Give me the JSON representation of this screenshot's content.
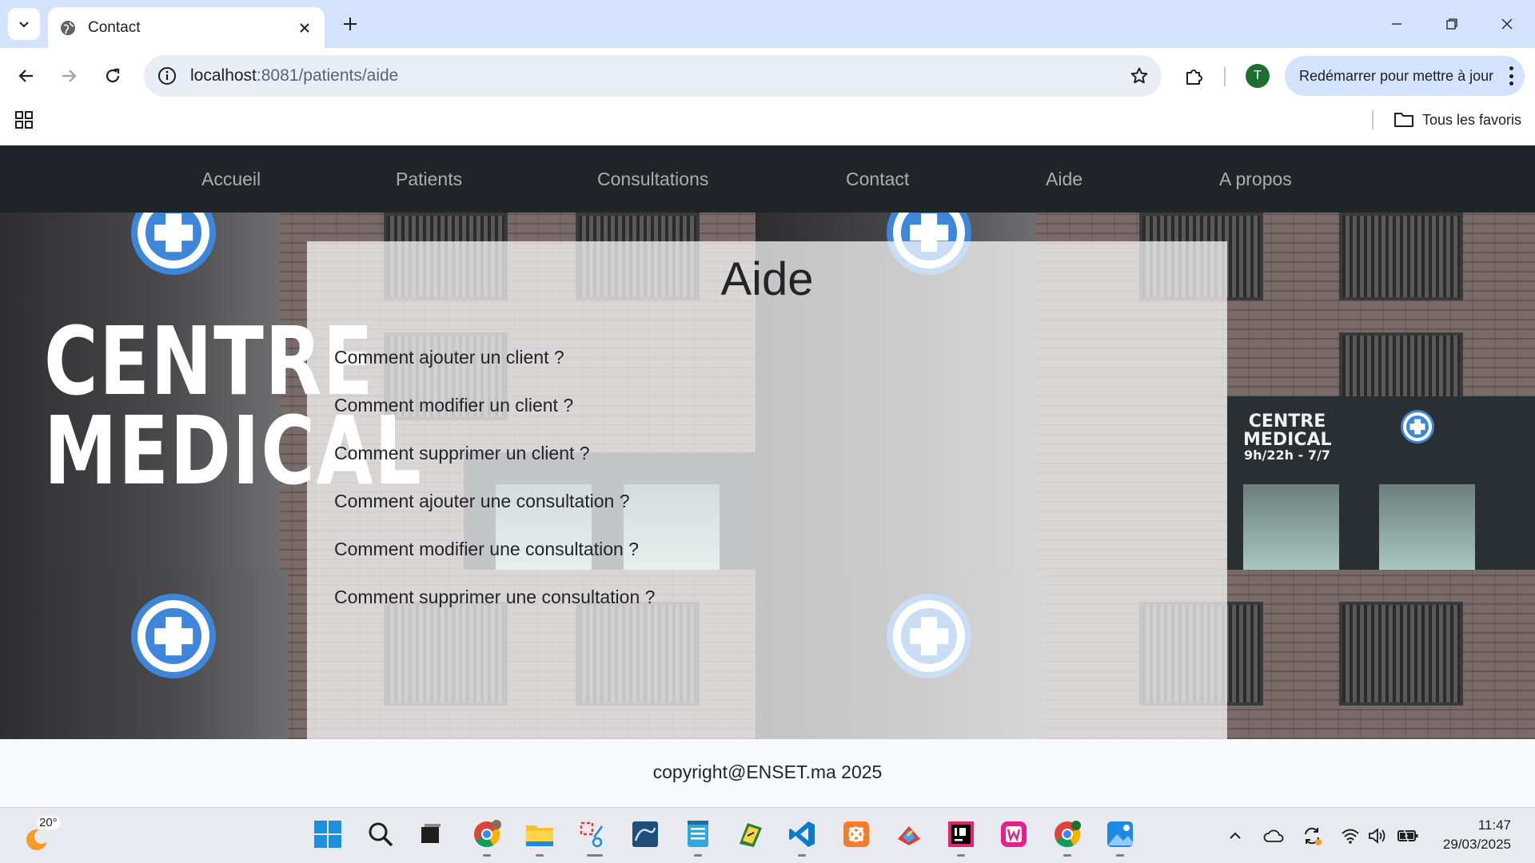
{
  "browser": {
    "tab_title": "Contact",
    "url_host": "localhost",
    "url_rest": ":8081/patients/aide",
    "update_button": "Redémarrer pour mettre à jour",
    "profile_initial": "T",
    "bookmarks_folder": "Tous les favoris"
  },
  "nav": {
    "items": [
      "Accueil",
      "Patients",
      "Consultations",
      "Contact",
      "Aide",
      "A propos"
    ]
  },
  "page": {
    "title": "Aide",
    "questions": [
      "Comment ajouter un client ?",
      "Comment modifier un client ?",
      "Comment supprimer un client ?",
      "Comment ajouter une consultation ?",
      "Comment modifier une consultation ?",
      "Comment supprimer une consultation ?"
    ],
    "hero_sign": {
      "line1": "CENTRE",
      "line2": "MEDICAL",
      "line3": "9h/22h - 7/7"
    },
    "footer": "copyright@ENSET.ma 2025"
  },
  "taskbar": {
    "weather_temp": "20°",
    "time": "11:47",
    "date": "29/03/2025",
    "icons": [
      "windows-start-icon",
      "search-icon",
      "task-view-icon",
      "chrome-icon",
      "file-explorer-icon",
      "snipping-tool-icon",
      "mysql-workbench-icon",
      "notepad-icon",
      "intellij-app-icon",
      "vscode-icon",
      "xampp-icon",
      "paint-icon",
      "intellij-idea-icon",
      "webstorm-icon",
      "chrome-profile-icon",
      "photos-icon"
    ]
  }
}
